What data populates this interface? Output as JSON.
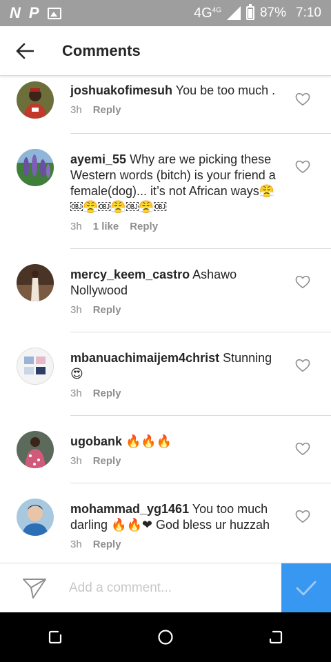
{
  "status_bar": {
    "left_icons": [
      "N",
      "P"
    ],
    "network": "4G",
    "network_sup": "4G",
    "battery": "87%",
    "time": "7:10"
  },
  "header": {
    "title": "Comments"
  },
  "comments": [
    {
      "username": "joshuakofimesuh",
      "text": "You be too much .",
      "time": "3h",
      "likes": "",
      "reply": "Reply",
      "avatar_color": "#c0392b"
    },
    {
      "username": "ayemi_55",
      "text": "Why are we picking these Western words (bitch) is your friend a female(dog)... it’s not African ways😤￼😤￼😤￼😤￼",
      "time": "3h",
      "likes": "1 like",
      "reply": "Reply",
      "avatar_color": "#6b4fa0"
    },
    {
      "username": "mercy_keem_castro",
      "text": "Ashawo Nollywood",
      "time": "3h",
      "likes": "",
      "reply": "Reply",
      "avatar_color": "#5a3a2a"
    },
    {
      "username": "mbanuachimaijem4christ",
      "text": "Stunning 😍",
      "time": "3h",
      "likes": "",
      "reply": "Reply",
      "avatar_color": "#9aa6b8"
    },
    {
      "username": "ugobank",
      "text": "🔥🔥🔥",
      "time": "3h",
      "likes": "",
      "reply": "Reply",
      "avatar_color": "#d15a7a"
    },
    {
      "username": "mohammad_yg1461",
      "text": "You too much darling 🔥🔥❤ God bless ur huzzah",
      "time": "3h",
      "likes": "",
      "reply": "Reply",
      "avatar_color": "#2c6fb5"
    }
  ],
  "composer": {
    "placeholder": "Add a comment..."
  },
  "colors": {
    "status_bar": "#9e9e9e",
    "accent": "#3897f0",
    "secondary_text": "#8e8e8e",
    "divider": "#dbdbdb"
  }
}
